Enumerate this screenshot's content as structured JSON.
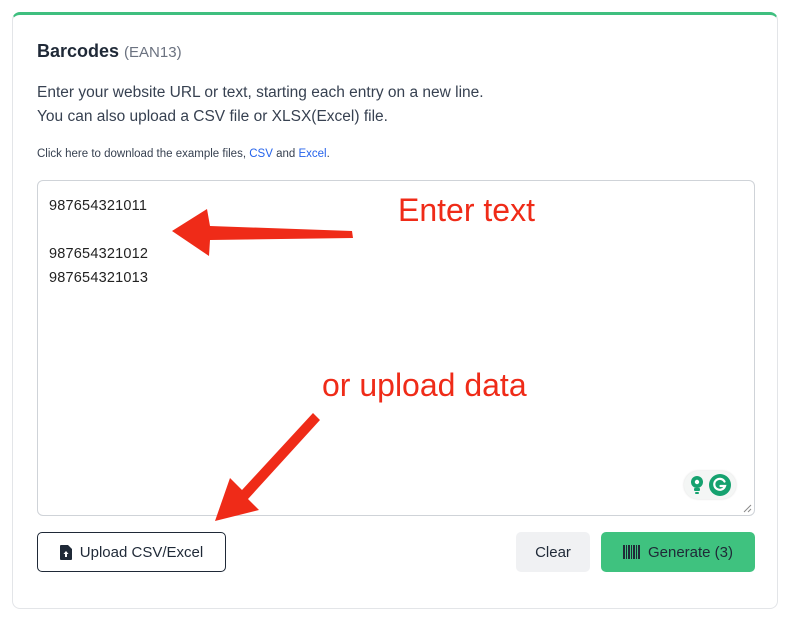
{
  "card": {
    "title": "Barcodes",
    "subtitle": "(EAN13)",
    "description": [
      "Enter your website URL or text, starting each entry on a new line.",
      "You can also upload a CSV file or XLSX(Excel) file."
    ],
    "note": {
      "prefix": "Click here to download the example files, ",
      "csv_link": "CSV",
      "and": " and ",
      "excel_link": "Excel",
      "suffix": "."
    }
  },
  "textarea": {
    "lines": [
      "987654321011",
      "",
      "987654321012",
      "987654321013"
    ]
  },
  "buttons": {
    "upload": "Upload CSV/Excel",
    "clear": "Clear",
    "generate": "Generate (3)"
  },
  "annotations": {
    "enter_text": "Enter text",
    "upload_data": "or upload data",
    "color": "#ef2b18"
  },
  "colors": {
    "accent": "#3fc27f",
    "link": "#2563eb",
    "grammarly": "#15a26f"
  }
}
